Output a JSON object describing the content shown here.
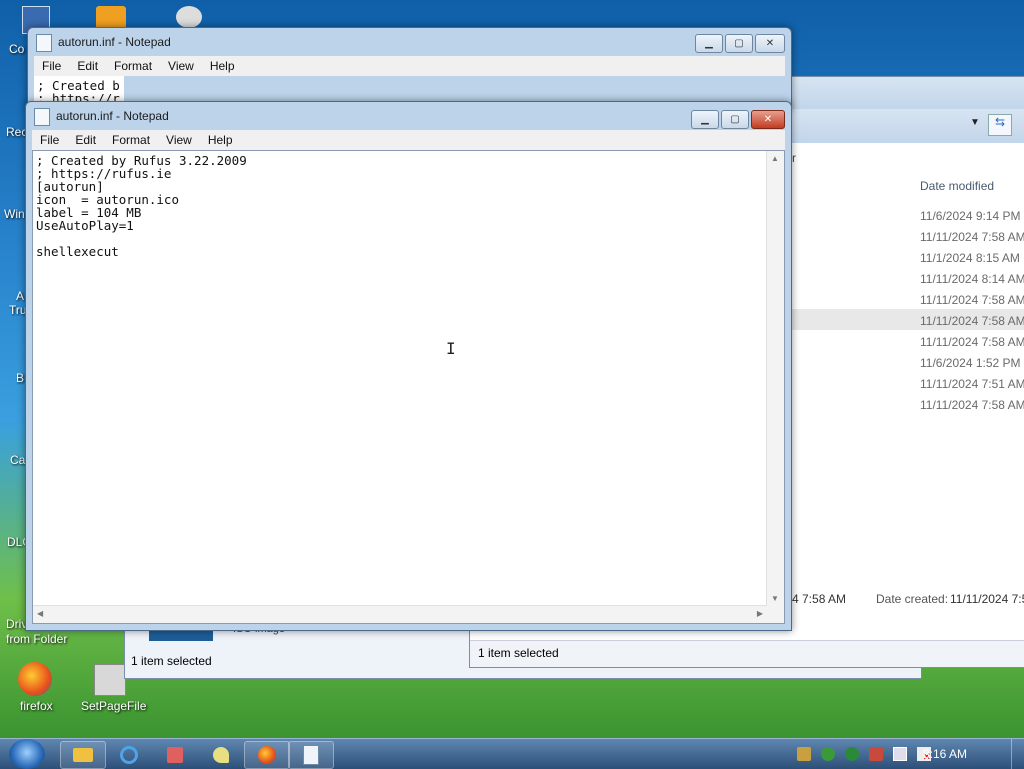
{
  "desktop": {
    "icons": [
      {
        "label": "Co",
        "name": "computer-icon"
      },
      {
        "label": "Rec",
        "name": "recycle-bin-icon"
      },
      {
        "label": "Win",
        "name": "windows-icon"
      },
      {
        "label": "A",
        "name": "shortcut-icon"
      },
      {
        "label": "Tru",
        "name": "shortcut-icon"
      },
      {
        "label": "B",
        "name": "shortcut-icon"
      },
      {
        "label": "Ca",
        "name": "shortcut-icon"
      },
      {
        "label": "DLC",
        "name": "shortcut-icon"
      },
      {
        "label": "Driv",
        "name": "shortcut-icon"
      },
      {
        "label": "from Folder",
        "name": "shortcut-icon"
      },
      {
        "label": "firefox",
        "name": "firefox-icon"
      },
      {
        "label": "SetPageFile",
        "name": "setpagefile-icon"
      }
    ]
  },
  "back_notepad": {
    "title": "autorun.inf - Notepad",
    "menu": [
      "File",
      "Edit",
      "Format",
      "View",
      "Help"
    ],
    "text_line1": "; Created b",
    "text_line2": "; https://r"
  },
  "notepad": {
    "title": "autorun.inf - Notepad",
    "menu": [
      "File",
      "Edit",
      "Format",
      "View",
      "Help"
    ],
    "content": "; Created by Rufus 3.22.2009\n; https://rufus.ie\n[autorun]\nicon  = autorun.ico\nlabel = 104 MB\nUseAutoPlay=1\n\nshellexecut"
  },
  "explorer": {
    "column_header": "Date modified",
    "breadcrumb_tail": "r",
    "dates": [
      "11/6/2024 9:14 PM",
      "11/11/2024 7:58 AM",
      "11/1/2024 8:15 AM",
      "11/11/2024 8:14 AM",
      "11/11/2024 7:58 AM",
      "11/11/2024 7:58 AM",
      "11/11/2024 7:58 AM",
      "11/6/2024 1:52 PM",
      "11/11/2024 7:51 AM",
      "11/11/2024 7:58 AM"
    ],
    "details_modified": "4 7:58 AM",
    "details_created_label": "Date created:",
    "details_created_value": "11/11/2024 7:5",
    "status": "1 item selected"
  },
  "explorer_back": {
    "status": "1 item selected",
    "file_hint": "ISO image"
  },
  "taskbar": {
    "clock": "8:16 AM"
  },
  "colors": {
    "accent": "#2c4f78",
    "close_button": "#c33c20"
  }
}
